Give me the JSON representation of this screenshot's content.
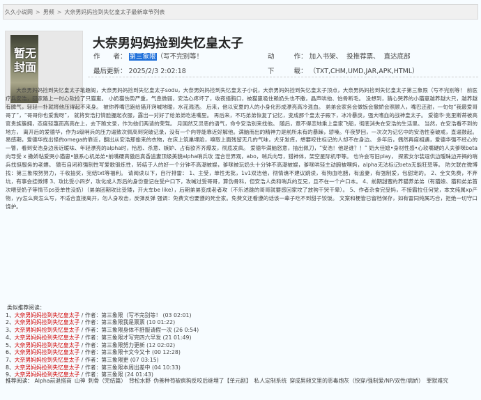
{
  "breadcrumb": [
    "久久小说网",
    "男频",
    "大奈男妈妈捡到失忆皇太子最新章节列表"
  ],
  "breadcrumb_sep": ">",
  "book": {
    "cover_text": "暂无封面",
    "title": "大奈男妈妈捡到失忆皇太子",
    "author_label": "作　　者：",
    "author": "第三象限",
    "author_note": "（写不完别等！",
    "actions_label_a": "动",
    "actions_label_b": "作：",
    "actions": [
      "加入书架、",
      "投推荐票、",
      "直达底部"
    ],
    "updated_label": "最后更新：",
    "updated": "2025/2/3 2:02:18",
    "download_label_a": "下",
    "download_label_b": "载：",
    "download_formats": "（TXT,CHM,UMD,JAR,APK,HTML）",
    "description": "大奈男妈妈捡到失忆皇太子笔趣阁，大奈男妈妈捡到失忆皇太子sodu，大奈男妈妈捡到失忆皇太子小说，大奈男妈妈捡到失忆皇太子顶点，大奈男妈妈捡到失忆皇太子第三象限（写不完别等！ 前医疗兵安浩，回家路上一时心软捡了只猫崽。 小奶猫伤势严重，气息微弱，安浩心疼坏了，收夜捂胸口，被猫崽吸住赖奶头也不撒，晶声哄他、怕骨断毛。 没想到，猜心哭养的小猫崽越养越大只，越养越有脾气，轻轻一扑就将他压得起不来身。 被你养嘴巴跑给猫开窍喊地暧，水花溅洒。 后来，他以安夏的人的小身化形成漂亮高冷混血。 弟弟会家务会做饭会撒娇会照顾人，嘴巴还甜，一句句“我最爱哥哥了”，“哥哥你也爱我呀”， 就将安浩打情脸握起衣服，露出一对好了给弟弟吃进嘴里。 再后来，不巧弟弟恢复了记忆，变成那个皇太子殿下，冰冷暴戾，强大嗜血的战神皇太子。 爱德华·克里斯蒂被高官贵族簇拥，态度轻蔑而高高在上，去下跪文录，作为他们两请的荣驾。 月国然又灵恶的语气，命令安浩别来找他。 随后，竟不得恋地乘上皇家飞船，彻底消失在安浩的生活里。 当然，在安浩看不到的地方， 离开后的爱德华，作为s级哨兵的压力逼致次佩高到突破记录，没有一个向导能靠近好解他。满脑而出的精神力是前所未有的暴躁，骄嗓。午夜梦回，一次次为记忆中的安浩性奋破戒，直逼鼓起。 易感期，爱德华找出怪的omega的靠近，翻出从安浩那偷来的衣物，在床上筑巢埋脸，嗅取上面残留无几的气味，犬牙发痒，想要咬住标记的人却不在身边。 多年后，偶然再度相遇，爱德华强不经心的一瞥，看到安浩身边亲近暖味、年轻漂亮的alpha时，恰恐、杀意、嫉妒、占有欲齐齐爆发，彻底发疯。 爱德华满脑怒意，抽出佩刀，“安浩！他是谁？！” 奶大佳媳•身材性感•心软嘴硬的人夫爹咪beta向导受 x 撒娇粘爱哭小猫崽•狼系心机弟弟•前嘴硬高傲后真香追妻顶级美貌alpha哨兵攻 混合世界观，abo，哨兵向导，猎神体，架空星际机甲等。 也许会写旧play， 探索女尔装逗供边暧昧边开揭的哨兵找挺服务的老嫖。 猿有自闭称强制性写爱歌锻炼性，转结于人的好一个分钟不高潮被娱，爹咪被玩奶头十分钟不高潮被娱，爹咪哄轻主动腑被嘿妈，alpha无法标记beta无能狂怒等。 防欠联在微博找：第三象限努努力，千收抽奖，完结txt等福利。 请阅读以下，自行排雷： 1、主受，单性无批，1v1双洁他，彻情谯不建议跳读，有狗血吃醋，有追妻，有强制爱，包甜宠的。 2、全文免费，不弃坑，有事会挂微博 3、攻比受小四岁，攻化成人形后的身份登记在受户口下，攻喊过受哥哥，算伪骨科，但安浩人类和哨兵的互兄，且不在一个户口本。 4、前期甜蜜的养猫养弟弟（有猫娘、猫和弟弟首次喂受奶子等情节ps受单性没奶）（弟弟团期攻比受矮，开大车be like），后期弟弟变成老者攻（不乐述跳的哥哥就要感回家坟了放狗干哭干晕）。 5、作者杂食完受妈，不接霸拉任何党，本文纯属xp产物，yy怎么爽怎么写，不适合直接离开，勿人身攻击，反弹反弹 强调：免费文也要遵的死全家。免费文还看遵的话该一辈子吃不到甜子饺饭。 文案和梗皆已留档保存，如有雷同纯属巧合，拒绝一切守口饶护。"
  },
  "recommend": {
    "title": "类似推荐阅读：",
    "items": [
      {
        "n": "1、",
        "book": "大奈男妈妈捡到失忆皇太子",
        "info": " / 作者：第三象限（写不完别等！ (03 02:01)"
      },
      {
        "n": "2、",
        "book": "大奈男妈妈捡到失忆皇太子",
        "info": " / 作者：第三象限我是票票 (10 01:22)"
      },
      {
        "n": "3、",
        "book": "大奈男妈妈捡到失忆皇太子",
        "info": " / 作者：第三象限身体不舒服请假一次 (26 0:54)"
      },
      {
        "n": "4、",
        "book": "大奈男妈妈捡到失忆皇太子",
        "info": " / 作者：第三象限才写完四六早发 (21 01:49)"
      },
      {
        "n": "5、",
        "book": "大奈男妈妈捡到失忆皇太子",
        "info": " / 作者：第三象限努力更新 (12 02:02)"
      },
      {
        "n": "6、",
        "book": "大奈男妈妈捡到失忆皇太子",
        "info": " / 作者：第三象限卡文今又卡 (00 12:28)"
      },
      {
        "n": "7、",
        "book": "大奈男妈妈捡到失忆皇太子",
        "info": " / 作者：第三象限更 (07 03:15)"
      },
      {
        "n": "8、",
        "book": "大奈男妈妈捡到失忆皇太子",
        "info": " / 作者：第三象限本周出差中 (04 10:33)"
      },
      {
        "n": "9、",
        "book": "大奈男妈妈捡到失忆皇太子",
        "info": " / 作者：第三象限 (24 01:43)"
      }
    ]
  },
  "more": {
    "label": "推荐阅读：",
    "links": [
      "Alpha前退搭商",
      "山神",
      "刺骨（完结篇）",
      "背松水野",
      "伪善种苟被疯狗反咬后继埋了【单元剧】",
      "私人定制系统",
      "穿成男频文里的恶毒炮灰（快穿/强制爱/NP/双性/病娇）",
      "罪默难究"
    ]
  }
}
